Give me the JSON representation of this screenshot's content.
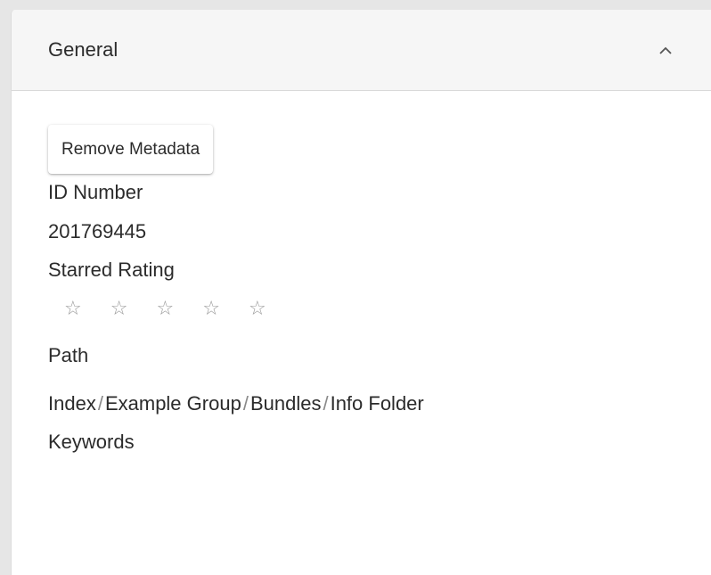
{
  "panel": {
    "title": "General",
    "collapse_icon": "chevron-up-icon"
  },
  "actions": {
    "remove_metadata_label": "Remove Metadata"
  },
  "fields": {
    "id_label": "ID Number",
    "id_value": "201769445",
    "rating_label": "Starred Rating",
    "rating_value": 0,
    "rating_max": 5,
    "star_glyph": "☆",
    "path_label": "Path",
    "path": [
      "Index",
      "Example Group",
      "Bundles",
      "Info Folder"
    ],
    "path_separator": "/",
    "keywords_label": "Keywords"
  }
}
